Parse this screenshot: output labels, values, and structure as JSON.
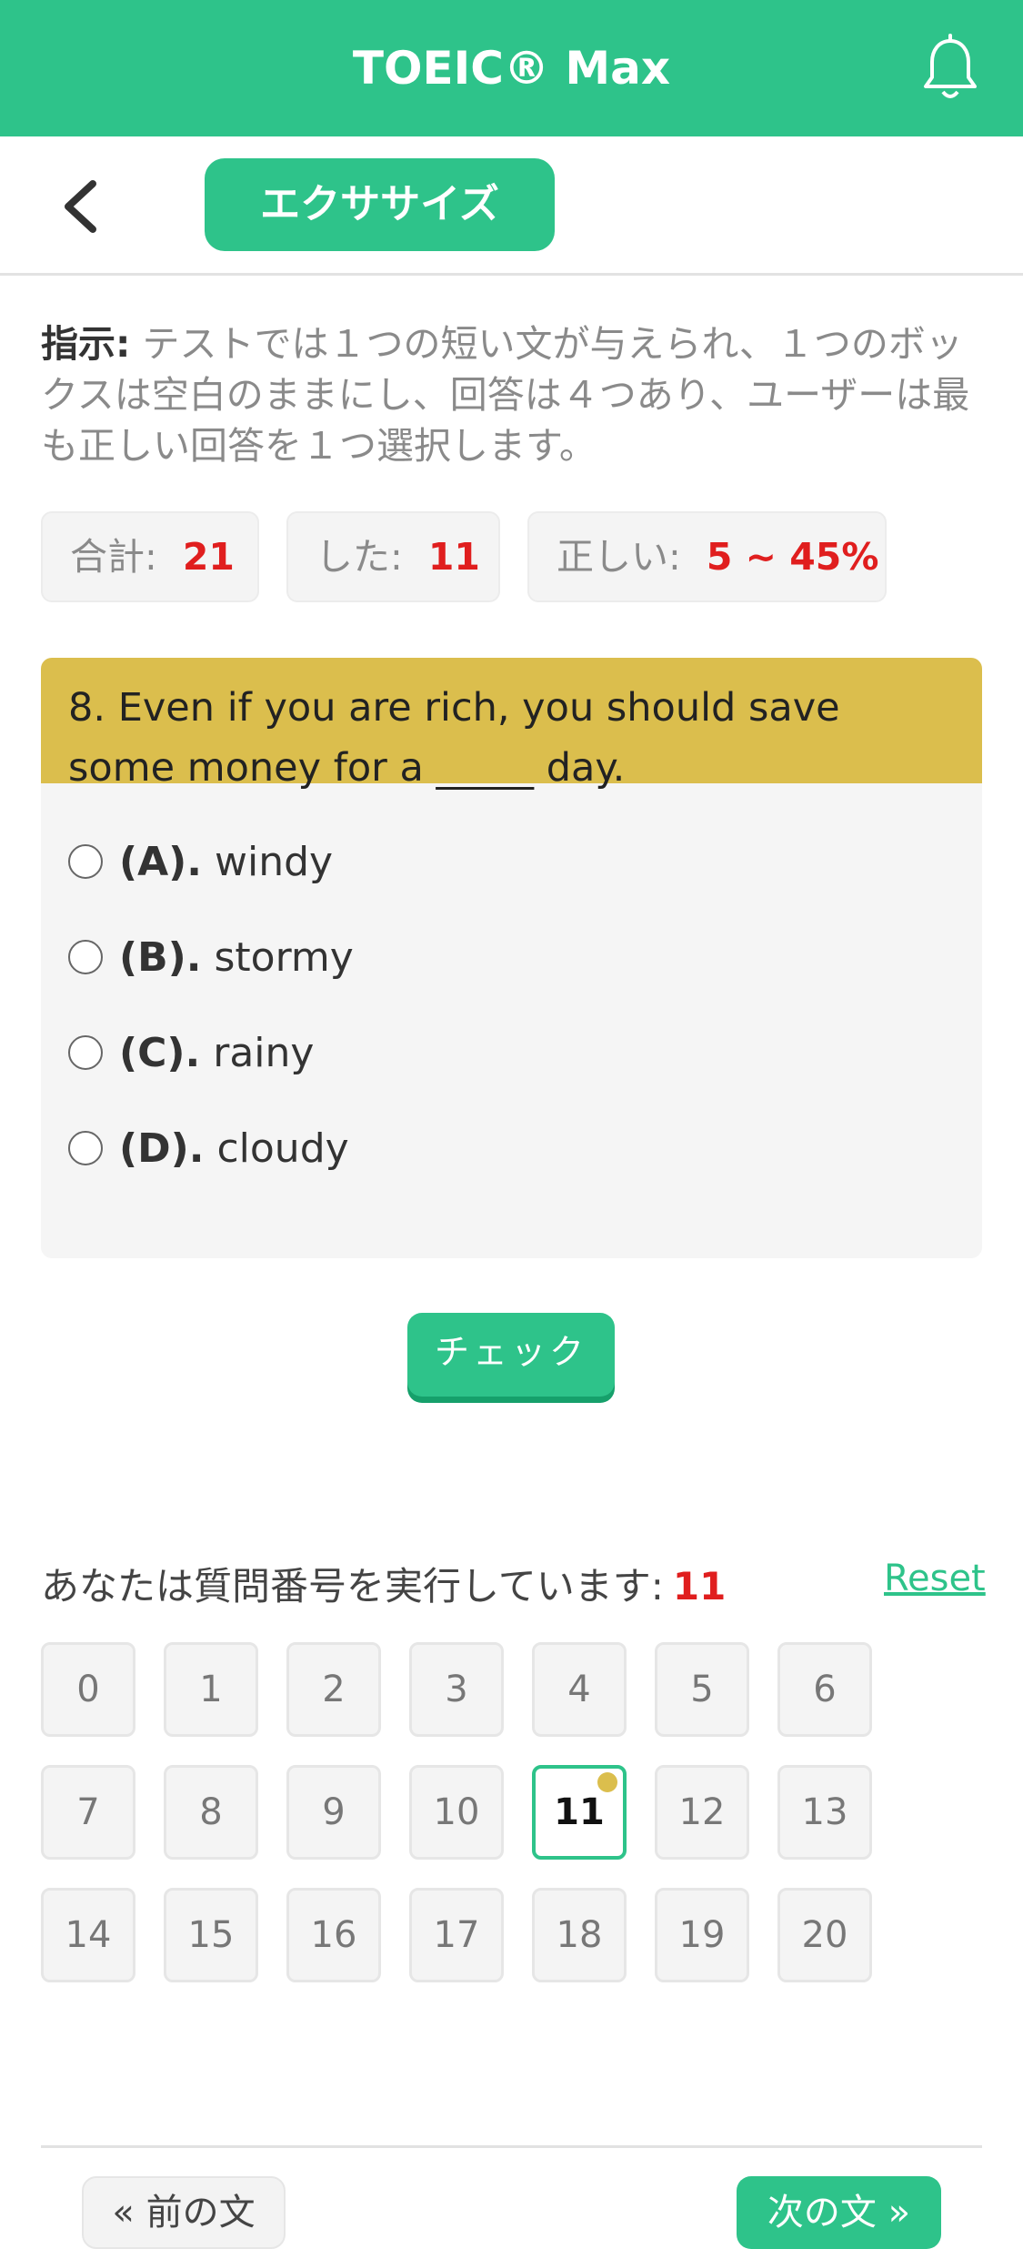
{
  "app": {
    "title": "TOEIC® Max"
  },
  "subbar": {
    "tab_label": "エクササイズ"
  },
  "instructions": {
    "label": "指示:",
    "text": " テストでは１つの短い文が与えられ、１つのボックスは空白のままにし、回答は４つあり、ユーザーは最も正しい回答を１つ選択します。"
  },
  "stats": {
    "total_label": "合計:",
    "total_value": "21",
    "done_label": "した:",
    "done_value": "11",
    "correct_label": "正しい:",
    "correct_value": "5 ~ 45%"
  },
  "question": {
    "text": "8. Even if you are rich, you should save some money for a _____ day.",
    "options": [
      {
        "letter": "(A).",
        "text": "windy"
      },
      {
        "letter": "(B).",
        "text": "stormy"
      },
      {
        "letter": "(C).",
        "text": "rainy"
      },
      {
        "letter": "(D).",
        "text": "cloudy"
      }
    ]
  },
  "check_label": "チェック",
  "progress": {
    "label": "あなたは質問番号を実行しています:",
    "current": "11",
    "reset_label": "Reset",
    "numbers": [
      "0",
      "1",
      "2",
      "3",
      "4",
      "5",
      "6",
      "7",
      "8",
      "9",
      "10",
      "11",
      "12",
      "13",
      "14",
      "15",
      "16",
      "17",
      "18",
      "19",
      "20"
    ]
  },
  "nav": {
    "prev_label": "« 前の文",
    "next_label": "次の文 »"
  },
  "colors": {
    "accent": "#2ec38a",
    "question_header": "#dbbe4d",
    "highlight": "#e01e1e"
  }
}
